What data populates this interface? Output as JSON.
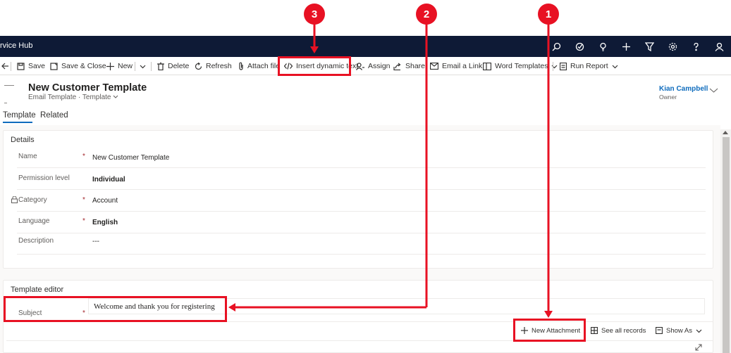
{
  "app": {
    "title": "rvice Hub"
  },
  "topbar_icons": [
    "search-icon",
    "task-icon",
    "lightbulb-icon",
    "plus-icon",
    "filter-icon",
    "gear-icon",
    "help-icon",
    "person-icon"
  ],
  "commands": {
    "save": "Save",
    "save_close": "Save & Close",
    "new": "New",
    "delete": "Delete",
    "refresh": "Refresh",
    "attach_file": "Attach file",
    "insert_dynamic_text": "Insert dynamic text",
    "assign": "Assign",
    "share": "Share",
    "email_link": "Email a Link",
    "word_templates": "Word Templates",
    "run_report": "Run Report"
  },
  "record": {
    "title": "New Customer Template",
    "entity": "Email Template",
    "form": "Template",
    "owner_name": "Kian Campbell",
    "owner_label": "Owner"
  },
  "tabs": [
    "Template",
    "Related"
  ],
  "details": {
    "title": "Details",
    "fields": [
      {
        "label": "Name",
        "required": "*",
        "value": "New Customer Template"
      },
      {
        "label": "Permission level",
        "required": "",
        "value": "Individual"
      },
      {
        "label": "Category",
        "required": "*",
        "value": "Account"
      },
      {
        "label": "Language",
        "required": "*",
        "value": "English"
      },
      {
        "label": "Description",
        "required": "",
        "value": "---"
      }
    ]
  },
  "editor": {
    "title": "Template editor",
    "subject_label": "Subject",
    "subject_required": "*",
    "subject_value": "Welcome and thank you for registering",
    "new_attachment": "New Attachment",
    "see_all_records": "See all records",
    "show_as": "Show As"
  },
  "callouts": [
    "1",
    "2",
    "3"
  ],
  "colors": {
    "accent": "#0f6cbd",
    "callout": "#e81123",
    "topbar": "#0e1a36"
  }
}
